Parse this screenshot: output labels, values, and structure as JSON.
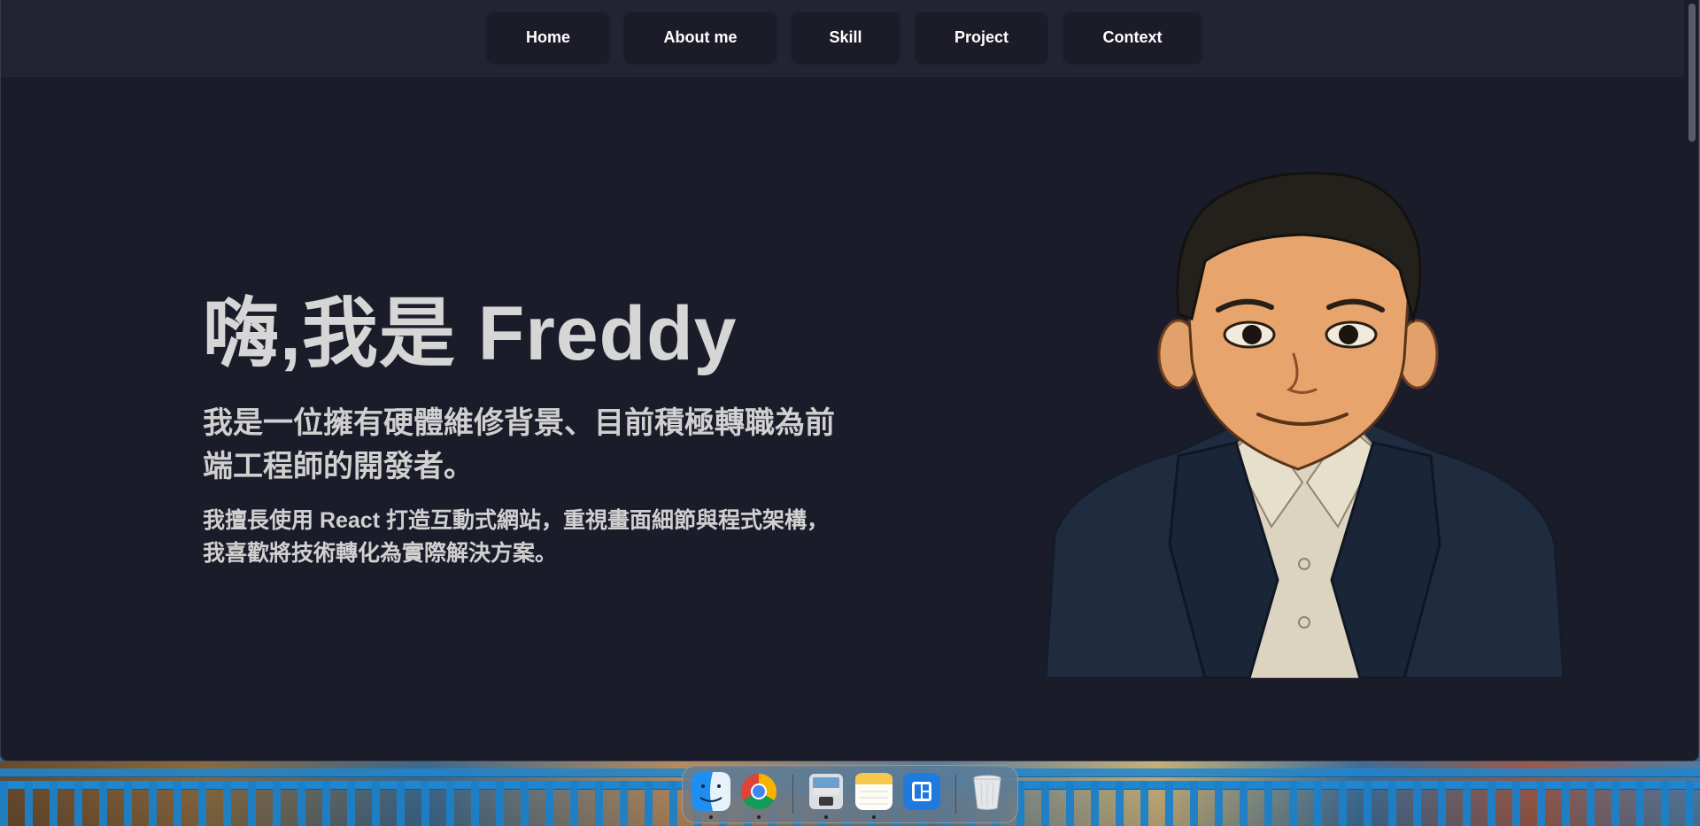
{
  "nav": {
    "items": [
      {
        "label": "Home"
      },
      {
        "label": "About me"
      },
      {
        "label": "Skill"
      },
      {
        "label": "Project"
      },
      {
        "label": "Context"
      }
    ]
  },
  "hero": {
    "title": "嗨,我是 Freddy",
    "subtitle": "我是一位擁有硬體維修背景、目前積極轉職為前端工程師的開發者。",
    "description": "我擅長使用 React 打造互動式網站，重視畫面細節與程式架構，我喜歡將技術轉化為實際解決方案。"
  },
  "dock": {
    "apps": [
      {
        "icon": "finder-icon"
      },
      {
        "icon": "chrome-icon"
      },
      {
        "icon": "preview-icon"
      },
      {
        "icon": "notes-icon"
      },
      {
        "icon": "windows-app-icon"
      },
      {
        "icon": "trash-icon"
      }
    ]
  },
  "colors": {
    "page_bg": "#1b1c2a",
    "nav_bg": "#232433",
    "button_bg": "#1b1c28",
    "text": "#d6d6d6"
  }
}
